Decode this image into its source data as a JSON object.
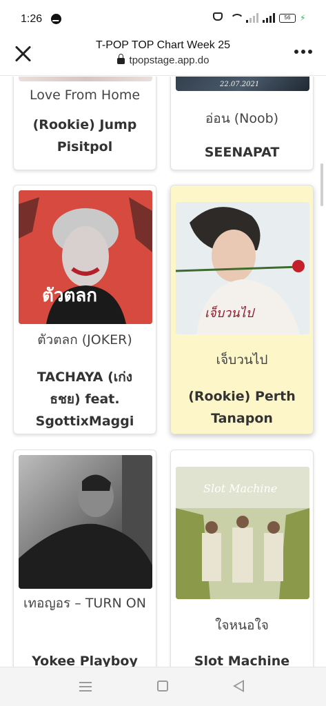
{
  "status_bar": {
    "time": "1:26",
    "battery": "56"
  },
  "browser": {
    "title": "T-POP TOP Chart Week 25",
    "domain": "tpopstage.app.do"
  },
  "chart_entries": [
    {
      "song": "Love From Home",
      "artist": "(Rookie) Jump Pisitpol",
      "cover_text": ""
    },
    {
      "song": "อ่อน (Noob)",
      "artist": "SEENAPAT",
      "cover_text": "22.07.2021"
    },
    {
      "song": "ตัวตลก (JOKER)",
      "artist": "TACHAYA (เก่ง ธชย) feat. SgottixMaggi",
      "cover_text": "ตัวตลก"
    },
    {
      "song": "เจ็บวนไป",
      "artist": "(Rookie) Perth Tanapon",
      "cover_text": "เจ็บวนไป",
      "highlighted": true
    },
    {
      "song": "เทอญอร – TURN ON",
      "artist": "Yokee Playboy",
      "cover_text": ""
    },
    {
      "song": "ใจหนอใจ",
      "artist": "Slot Machine",
      "cover_text": "Slot Machine"
    }
  ],
  "colors": {
    "highlight_card": "#fdf6c9",
    "joker_cover": "#d9473f",
    "perth_cover": "#e6ecec",
    "slot_cover": "#b9c48f"
  }
}
